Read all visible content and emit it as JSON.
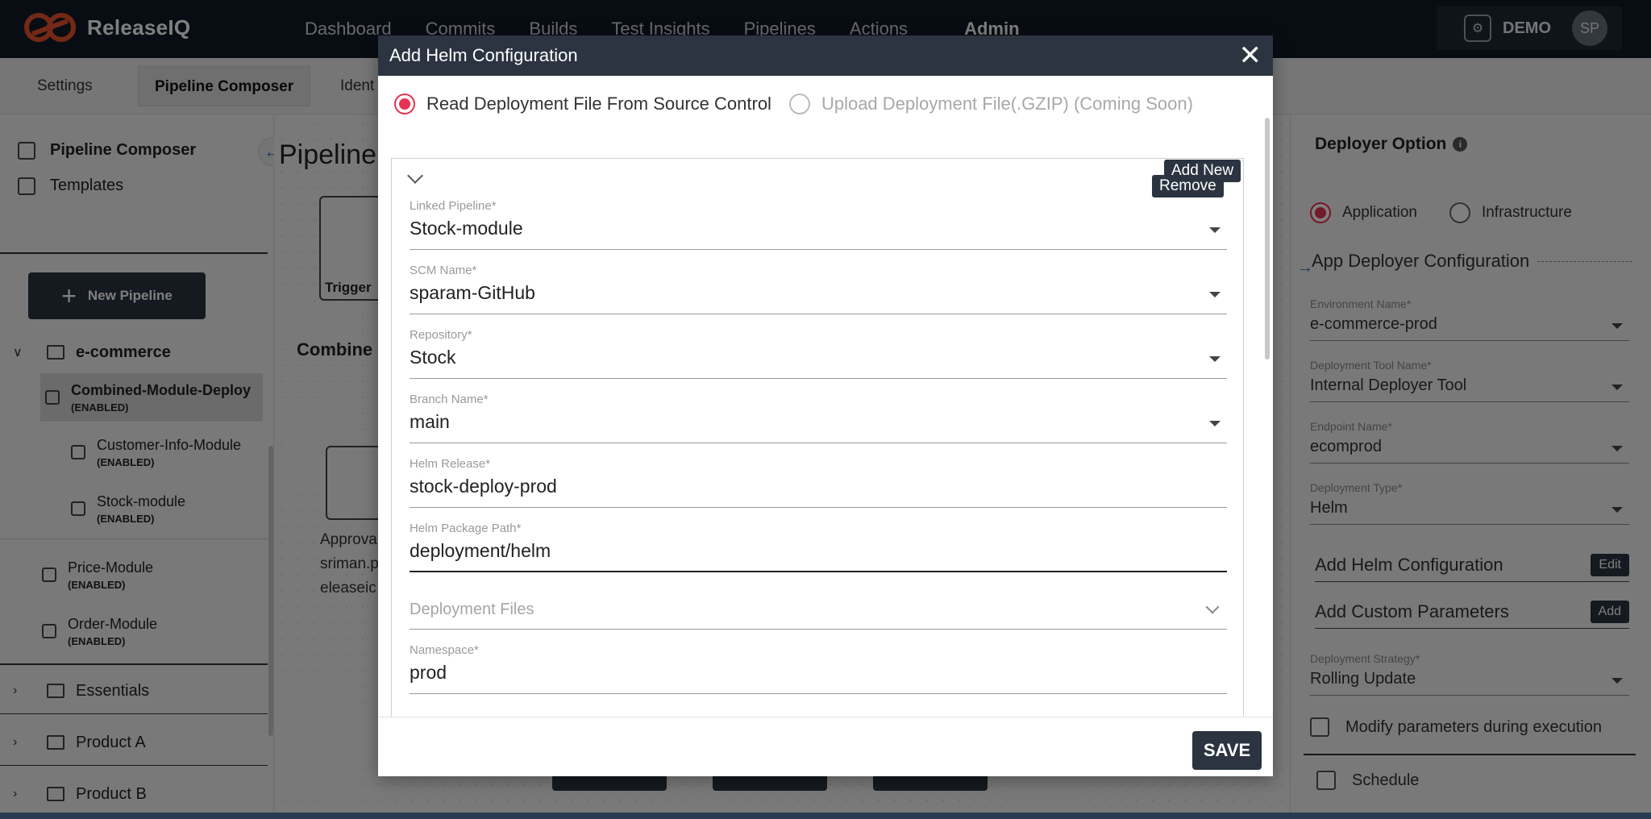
{
  "app": {
    "brand": "ReleaseIQ",
    "nav": [
      "Dashboard",
      "Commits",
      "Builds",
      "Test Insights",
      "Pipelines",
      "Actions"
    ],
    "nav_active": "Admin",
    "user_label": "DEMO",
    "user_initials": "SP",
    "brand_color": "#e8532f"
  },
  "subtabs": {
    "settings": "Settings",
    "composer": "Pipeline Composer",
    "identity": "Ident"
  },
  "sidebar": {
    "pipeline_composer": "Pipeline Composer",
    "templates": "Templates",
    "new_pipeline": "New Pipeline",
    "groups": [
      {
        "label": "e-commerce"
      },
      {
        "label": "Essentials"
      },
      {
        "label": "Product A"
      },
      {
        "label": "Product B"
      }
    ],
    "items": [
      {
        "name": "Combined-Module-Deploy",
        "status": "(ENABLED)"
      },
      {
        "name": "Customer-Info-Module",
        "status": "(ENABLED)"
      },
      {
        "name": "Stock-module",
        "status": "(ENABLED)"
      },
      {
        "name": "Price-Module",
        "status": "(ENABLED)"
      },
      {
        "name": "Order-Module",
        "status": "(ENABLED)"
      }
    ]
  },
  "canvas": {
    "title": "Pipeline",
    "trigger": "Trigger",
    "combined": "Combine",
    "approval_lines": [
      "Approva",
      "sriman.p",
      "eleaseic"
    ]
  },
  "right_panel": {
    "title": "Deployer Option",
    "radio_app": "Application",
    "radio_infra": "Infrastructure",
    "section": "App Deployer Configuration",
    "env_label": "Environment Name*",
    "env_value": "e-commerce-prod",
    "tool_label": "Deployment Tool Name*",
    "tool_value": "Internal Deployer Tool",
    "endpoint_label": "Endpoint Name*",
    "endpoint_value": "ecomprod",
    "type_label": "Deployment Type*",
    "type_value": "Helm",
    "helm_config": "Add Helm Configuration",
    "helm_btn": "Edit",
    "custom_params": "Add Custom Parameters",
    "custom_btn": "Add",
    "strategy_label": "Deployment Strategy*",
    "strategy_value": "Rolling Update",
    "modify_params": "Modify parameters during execution",
    "schedule": "Schedule"
  },
  "modal": {
    "title": "Add Helm Configuration",
    "option_source": "Read Deployment File From Source Control",
    "option_upload": "Upload Deployment File(.GZIP) (Coming Soon)",
    "add_new": "Add New",
    "remove": "Remove",
    "fields": {
      "linked_pipeline": {
        "label": "Linked Pipeline*",
        "value": "Stock-module"
      },
      "scm_name": {
        "label": "SCM Name*",
        "value": "sparam-GitHub"
      },
      "repository": {
        "label": "Repository*",
        "value": "Stock"
      },
      "branch": {
        "label": "Branch Name*",
        "value": "main"
      },
      "helm_release": {
        "label": "Helm Release*",
        "value": "stock-deploy-prod"
      },
      "helm_path": {
        "label": "Helm Package Path*",
        "value": "deployment/helm"
      },
      "deployment_files": {
        "placeholder": "Deployment Files"
      },
      "namespace": {
        "label": "Namespace*",
        "value": "prod"
      }
    },
    "save": "SAVE"
  }
}
